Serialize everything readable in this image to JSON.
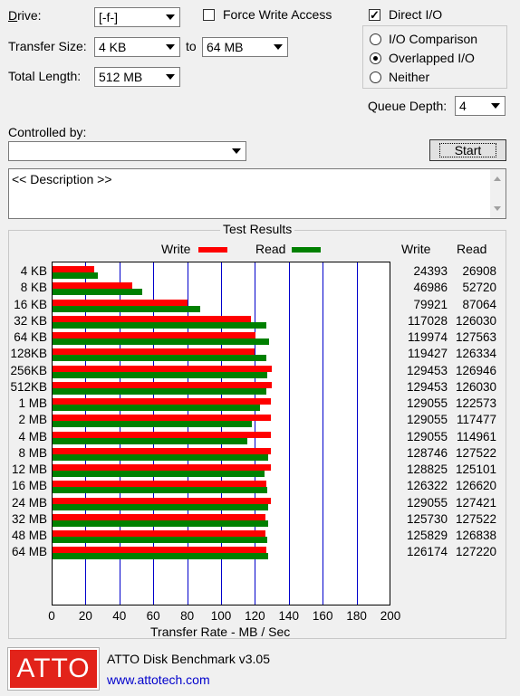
{
  "form": {
    "drive_label": "Drive:",
    "drive_value": "[-f-]",
    "force_write_label": "Force Write Access",
    "force_write_checked": false,
    "direct_io_label": "Direct I/O",
    "direct_io_checked": true,
    "transfer_size_label": "Transfer Size:",
    "transfer_from": "4 KB",
    "to_label": "to",
    "transfer_to": "64 MB",
    "total_length_label": "Total Length:",
    "total_length_value": "512 MB",
    "io_comparison_label": "I/O Comparison",
    "overlapped_io_label": "Overlapped I/O",
    "neither_label": "Neither",
    "io_mode_selected": "Overlapped I/O",
    "queue_depth_label": "Queue Depth:",
    "queue_depth_value": "4",
    "controlled_by_label": "Controlled by:",
    "controlled_by_value": "",
    "start_label": "Start",
    "description_text": "<< Description >>"
  },
  "results": {
    "group_title": "Test Results",
    "legend_write": "Write",
    "legend_read": "Read",
    "col_write": "Write",
    "col_read": "Read",
    "write_color": "#ff0000",
    "read_color": "#008000",
    "grid_color": "#0000cc"
  },
  "chart_data": {
    "type": "bar",
    "orientation": "horizontal",
    "title": "Test Results",
    "xlabel": "Transfer Rate - MB / Sec",
    "xlim": [
      0,
      200
    ],
    "xticks": [
      0,
      20,
      40,
      60,
      80,
      100,
      120,
      140,
      160,
      180,
      200
    ],
    "categories": [
      "4 KB",
      "8 KB",
      "16 KB",
      "32 KB",
      "64 KB",
      "128KB",
      "256KB",
      "512KB",
      "1 MB",
      "2 MB",
      "4 MB",
      "8 MB",
      "12 MB",
      "16 MB",
      "24 MB",
      "32 MB",
      "48 MB",
      "64 MB"
    ],
    "series": [
      {
        "name": "Write",
        "color": "#ff0000",
        "values": [
          24393,
          46986,
          79921,
          117028,
          119974,
          119427,
          129453,
          129453,
          129055,
          129055,
          129055,
          128746,
          128825,
          126322,
          129055,
          125730,
          125829,
          126174
        ]
      },
      {
        "name": "Read",
        "color": "#008000",
        "values": [
          26908,
          52720,
          87064,
          126030,
          127563,
          126334,
          126946,
          126030,
          122573,
          117477,
          114961,
          127522,
          125101,
          126620,
          127421,
          127522,
          126838,
          127220
        ]
      }
    ],
    "legend": "top",
    "grid": true
  },
  "footer": {
    "logo_text": "ATTO",
    "app_title": "ATTO Disk Benchmark v3.05",
    "url": "www.attotech.com"
  }
}
